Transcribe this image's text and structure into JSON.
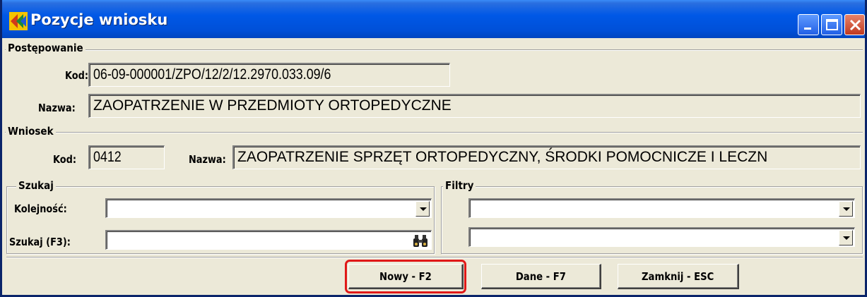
{
  "window": {
    "title": "Pozycje wniosku",
    "icon": "app-logo-icon",
    "controls": [
      "minimize-icon",
      "maximize-icon",
      "close-icon"
    ],
    "title_color": "#0054E3"
  },
  "postepowanie": {
    "legend": "Postępowanie",
    "kod_label": "Kod:",
    "kod_value": "06-09-000001/ZPO/12/2/12.2970.033.09/6",
    "nazwa_label": "Nazwa:",
    "nazwa_value": "ZAOPATRZENIE W PRZEDMIOTY ORTOPEDYCZNE"
  },
  "wniosek": {
    "legend": "Wniosek",
    "kod_label": "Kod:",
    "kod_value": "0412",
    "nazwa_label": "Nazwa:",
    "nazwa_value": "ZAOPATRZENIE SPRZĘT ORTOPEDYCZNY, ŚRODKI POMOCNICZE I LECZN"
  },
  "szukaj": {
    "legend": "Szukaj",
    "kolejnosc_label": "Kolejność:",
    "kolejnosc_value": "",
    "szukaj_label": "Szukaj (F3):",
    "szukaj_value": "",
    "search_icon": "binoculars-icon"
  },
  "filtry": {
    "legend": "Filtry",
    "filter1_value": "",
    "filter2_value": ""
  },
  "buttons": {
    "nowy": "Nowy - F2",
    "dane": "Dane - F7",
    "zamknij": "Zamknij - ESC"
  },
  "colors": {
    "highlight": "#E01818",
    "window_bg": "#ECE9D8"
  }
}
